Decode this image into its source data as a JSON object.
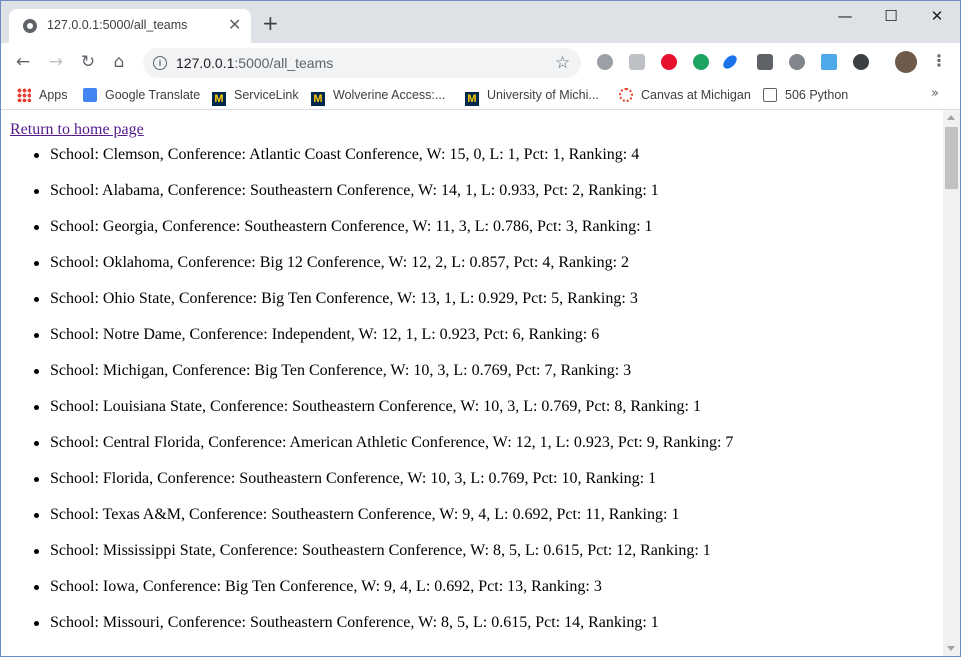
{
  "browser": {
    "tab_title": "127.0.0.1:5000/all_teams",
    "url_host": "127.0.0.1",
    "url_path": ":5000/all_teams",
    "bookmarks": [
      {
        "label": "Apps",
        "icon": "apps-grid-icon"
      },
      {
        "label": "Google Translate",
        "icon": "google-translate-icon"
      },
      {
        "label": "ServiceLink",
        "icon": "michigan-logo-icon"
      },
      {
        "label": "Wolverine Access:...",
        "icon": "michigan-logo-icon"
      },
      {
        "label": "University of Michi...",
        "icon": "michigan-logo-icon"
      },
      {
        "label": "Canvas at Michigan",
        "icon": "canvas-icon"
      },
      {
        "label": "506 Python",
        "icon": "python-icon"
      }
    ]
  },
  "page": {
    "home_link": "Return to home page",
    "teams": [
      "School: Clemson, Conference: Atlantic Coast Conference, W: 15, 0, L: 1, Pct: 1, Ranking: 4",
      "School: Alabama, Conference: Southeastern Conference, W: 14, 1, L: 0.933, Pct: 2, Ranking: 1",
      "School: Georgia, Conference: Southeastern Conference, W: 11, 3, L: 0.786, Pct: 3, Ranking: 1",
      "School: Oklahoma, Conference: Big 12 Conference, W: 12, 2, L: 0.857, Pct: 4, Ranking: 2",
      "School: Ohio State, Conference: Big Ten Conference, W: 13, 1, L: 0.929, Pct: 5, Ranking: 3",
      "School: Notre Dame, Conference: Independent, W: 12, 1, L: 0.923, Pct: 6, Ranking: 6",
      "School: Michigan, Conference: Big Ten Conference, W: 10, 3, L: 0.769, Pct: 7, Ranking: 3",
      "School: Louisiana State, Conference: Southeastern Conference, W: 10, 3, L: 0.769, Pct: 8, Ranking: 1",
      "School: Central Florida, Conference: American Athletic Conference, W: 12, 1, L: 0.923, Pct: 9, Ranking: 7",
      "School: Florida, Conference: Southeastern Conference, W: 10, 3, L: 0.769, Pct: 10, Ranking: 1",
      "School: Texas A&M, Conference: Southeastern Conference, W: 9, 4, L: 0.692, Pct: 11, Ranking: 1",
      "School: Mississippi State, Conference: Southeastern Conference, W: 8, 5, L: 0.615, Pct: 12, Ranking: 1",
      "School: Iowa, Conference: Big Ten Conference, W: 9, 4, L: 0.692, Pct: 13, Ranking: 3",
      "School: Missouri, Conference: Southeastern Conference, W: 8, 5, L: 0.615, Pct: 14, Ranking: 1"
    ]
  }
}
